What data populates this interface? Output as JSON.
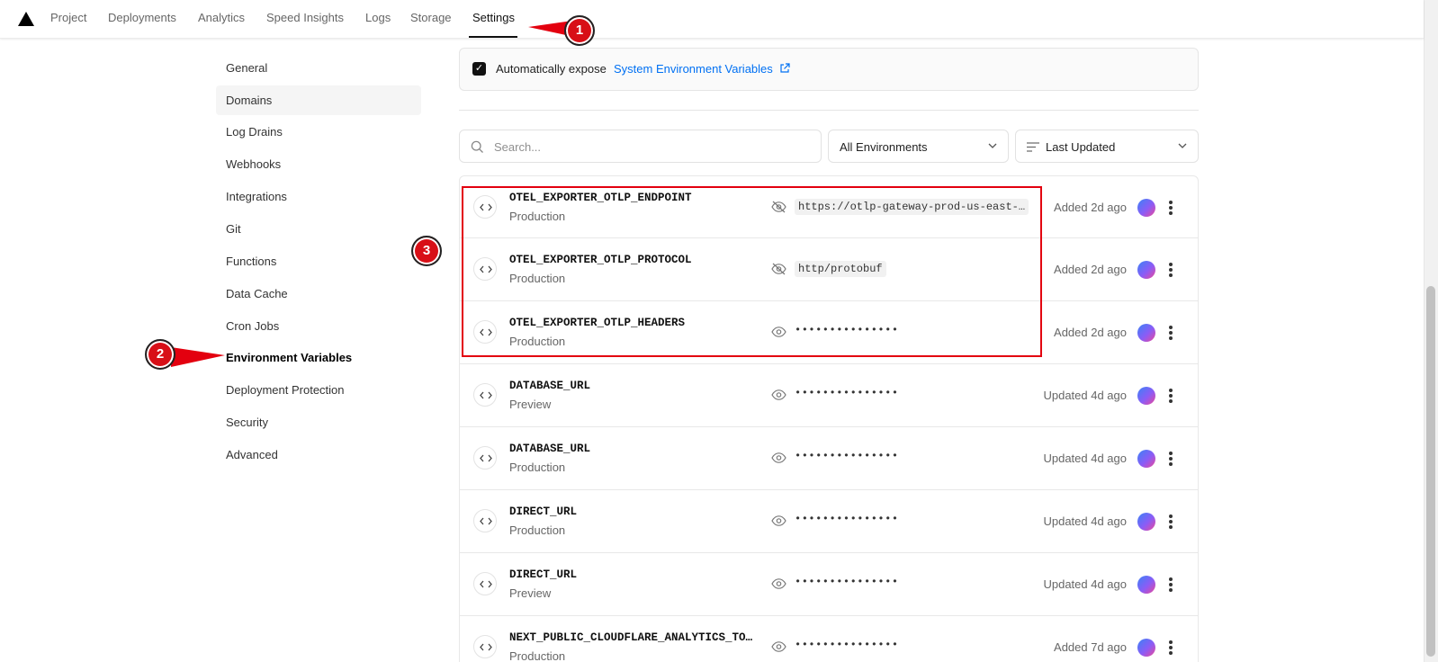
{
  "nav": {
    "tabs": [
      {
        "label": "Project"
      },
      {
        "label": "Deployments"
      },
      {
        "label": "Analytics"
      },
      {
        "label": "Speed Insights"
      },
      {
        "label": "Logs"
      },
      {
        "label": "Storage"
      },
      {
        "label": "Settings",
        "active": true
      }
    ]
  },
  "sidebar": {
    "items": [
      {
        "label": "General"
      },
      {
        "label": "Domains"
      },
      {
        "label": "Log Drains"
      },
      {
        "label": "Webhooks"
      },
      {
        "label": "Integrations"
      },
      {
        "label": "Git"
      },
      {
        "label": "Functions"
      },
      {
        "label": "Data Cache"
      },
      {
        "label": "Cron Jobs"
      },
      {
        "label": "Environment Variables",
        "active": true
      },
      {
        "label": "Deployment Protection"
      },
      {
        "label": "Security"
      },
      {
        "label": "Advanced"
      }
    ]
  },
  "expose": {
    "checked": true,
    "text": "Automatically expose",
    "link": "System Environment Variables"
  },
  "filters": {
    "search_placeholder": "Search...",
    "environment": "All Environments",
    "sort": "Last Updated"
  },
  "env_vars": [
    {
      "name": "OTEL_EXPORTER_OTLP_ENDPOINT",
      "env": "Production",
      "visible": true,
      "value": "https://otlp-gateway-prod-us-east-…",
      "ago": "Added 2d ago"
    },
    {
      "name": "OTEL_EXPORTER_OTLP_PROTOCOL",
      "env": "Production",
      "visible": true,
      "value": "http/protobuf",
      "ago": "Added 2d ago"
    },
    {
      "name": "OTEL_EXPORTER_OTLP_HEADERS",
      "env": "Production",
      "visible": false,
      "value": "•••••••••••••••",
      "ago": "Added 2d ago"
    },
    {
      "name": "DATABASE_URL",
      "env": "Preview",
      "visible": false,
      "value": "•••••••••••••••",
      "ago": "Updated 4d ago"
    },
    {
      "name": "DATABASE_URL",
      "env": "Production",
      "visible": false,
      "value": "•••••••••••••••",
      "ago": "Updated 4d ago"
    },
    {
      "name": "DIRECT_URL",
      "env": "Production",
      "visible": false,
      "value": "•••••••••••••••",
      "ago": "Updated 4d ago"
    },
    {
      "name": "DIRECT_URL",
      "env": "Preview",
      "visible": false,
      "value": "•••••••••••••••",
      "ago": "Updated 4d ago"
    },
    {
      "name": "NEXT_PUBLIC_CLOUDFLARE_ANALYTICS_TO…",
      "env": "Production",
      "visible": false,
      "value": "•••••••••••••••",
      "ago": "Added 7d ago"
    }
  ],
  "annotations": {
    "badges": [
      "1",
      "2",
      "3"
    ],
    "color": "#d80f17"
  },
  "colors": {
    "link": "#0070f3",
    "text": "#171717",
    "muted": "#666666"
  }
}
